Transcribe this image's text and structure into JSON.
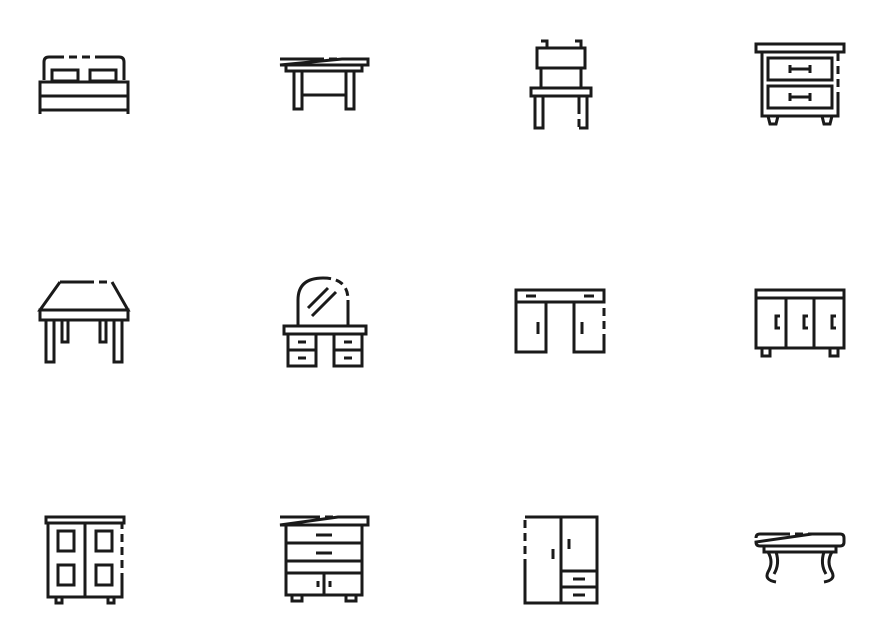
{
  "colors": {
    "background": "#ffffff",
    "stroke": "#1a1a1a"
  },
  "icons": [
    {
      "name": "double-bed-icon"
    },
    {
      "name": "side-table-icon"
    },
    {
      "name": "chair-icon"
    },
    {
      "name": "nightstand-icon"
    },
    {
      "name": "dining-table-icon"
    },
    {
      "name": "vanity-dresser-icon"
    },
    {
      "name": "desk-icon"
    },
    {
      "name": "sideboard-icon"
    },
    {
      "name": "wardrobe-icon"
    },
    {
      "name": "chest-of-drawers-icon"
    },
    {
      "name": "closet-icon"
    },
    {
      "name": "coffee-table-icon"
    }
  ]
}
